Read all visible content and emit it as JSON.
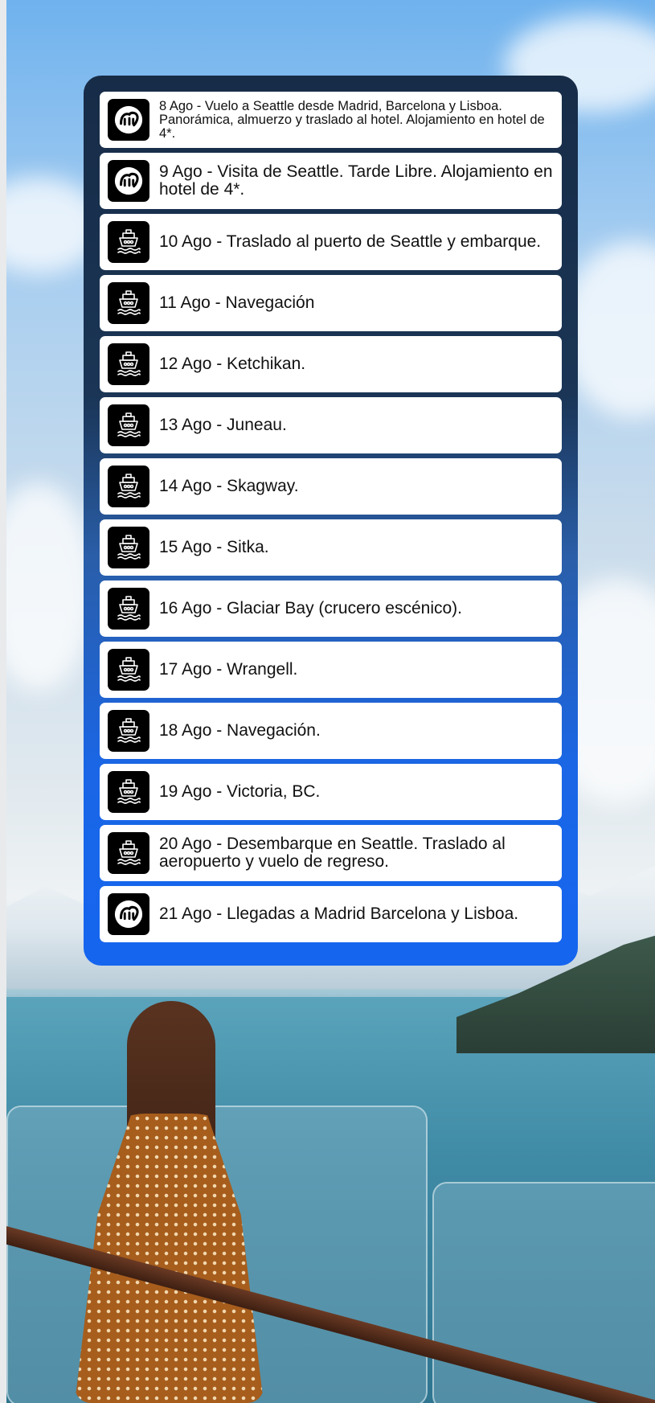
{
  "itinerary": {
    "items": [
      {
        "icon": "brand-logo-icon",
        "text": "8 Ago - Vuelo a Seattle desde Madrid, Barcelona y Lisboa. Panorámica, almuerzo y traslado al hotel. Alojamiento en hotel de 4*."
      },
      {
        "icon": "brand-logo-icon",
        "text": "9 Ago - Visita de Seattle. Tarde Libre. Alojamiento en hotel de 4*."
      },
      {
        "icon": "ship-icon",
        "text": "10 Ago - Traslado al puerto de Seattle y embarque."
      },
      {
        "icon": "ship-icon",
        "text": "11 Ago - Navegación"
      },
      {
        "icon": "ship-icon",
        "text": "12 Ago - Ketchikan."
      },
      {
        "icon": "ship-icon",
        "text": "13 Ago - Juneau."
      },
      {
        "icon": "ship-icon",
        "text": "14 Ago - Skagway."
      },
      {
        "icon": "ship-icon",
        "text": "15 Ago - Sitka."
      },
      {
        "icon": "ship-icon",
        "text": "16 Ago - Glaciar Bay (crucero escénico)."
      },
      {
        "icon": "ship-icon",
        "text": "17 Ago - Wrangell."
      },
      {
        "icon": "ship-icon",
        "text": "18 Ago - Navegación."
      },
      {
        "icon": "ship-icon",
        "text": "19 Ago - Victoria, BC."
      },
      {
        "icon": "ship-icon",
        "text": "20 Ago - Desembarque en Seattle. Traslado al aeropuerto y vuelo de regreso."
      },
      {
        "icon": "brand-logo-icon",
        "text": "21 Ago - Llegadas a Madrid Barcelona y Lisboa."
      }
    ]
  },
  "colors": {
    "panel_top": "#172c47",
    "panel_bottom": "#1565ef",
    "row_background": "#ffffff",
    "icon_background": "#000000"
  }
}
